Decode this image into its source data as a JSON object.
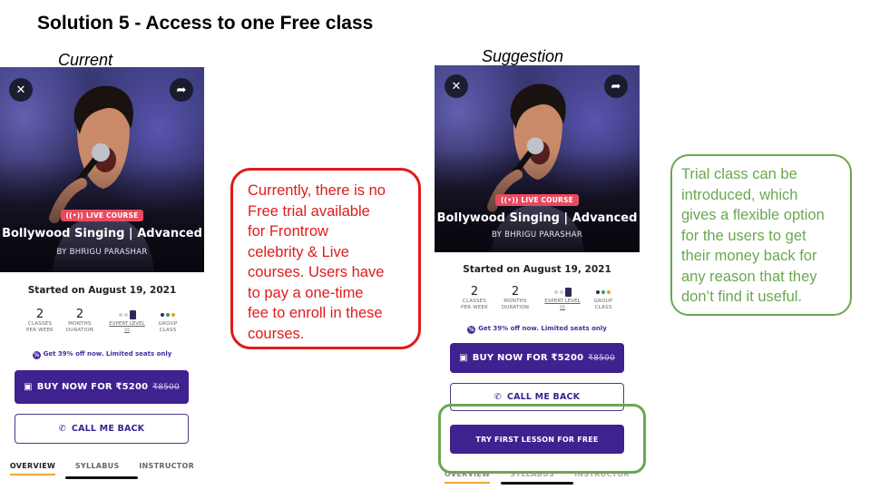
{
  "slide": {
    "title": "Solution 5 - Access to one Free class",
    "current_label": "Current",
    "suggestion_label": "Suggestion"
  },
  "course": {
    "badge": "LIVE COURSE",
    "title": "Bollywood Singing | Advanced",
    "author": "BY BHRIGU PARASHAR",
    "started": "Started on August 19, 2021",
    "stats": {
      "classes_num": "2",
      "classes_label_1": "CLASSES",
      "classes_label_2": "PER WEEK",
      "months_num": "2",
      "months_label_1": "MONTHS",
      "months_label_2": "DURATION",
      "level_label_1": "EXPERT LEVEL",
      "level_label_2": "(i)",
      "group_label_1": "GROUP",
      "group_label_2": "CLASS"
    },
    "offer": "Get 39% off now. Limited seats only",
    "buy_label": "BUY NOW FOR ₹5200",
    "buy_strike": "₹8500",
    "call_label": "CALL ME BACK",
    "trial_label": "TRY FIRST LESSON FOR FREE",
    "tabs": [
      "OVERVIEW",
      "SYLLABUS",
      "INSTRUCTOR"
    ]
  },
  "notes": {
    "current": [
      "Currently, there is no",
      "Free trial available",
      "for Frontrow",
      "celebrity & Live",
      "courses. Users have",
      "to pay a one-time",
      "fee to enroll in these",
      "courses."
    ],
    "suggestion": [
      "Trial class can be",
      "introduced, which",
      "gives a flexible option",
      "for the users to get",
      "their money back for",
      "any reason that they",
      "don’t find it useful."
    ]
  },
  "colors": {
    "brand_purple": "#3d2290",
    "live_red": "#e84a5f",
    "note_red": "#e01b1b",
    "note_green": "#6aa84f",
    "tab_accent": "#f2a33a"
  },
  "icons": {
    "close": "close-icon",
    "share": "share-icon",
    "buy": "wallet-icon",
    "call": "phone-icon",
    "offer": "percent-icon",
    "live": "broadcast-icon",
    "level": "bars-icon",
    "group": "group-icon"
  }
}
